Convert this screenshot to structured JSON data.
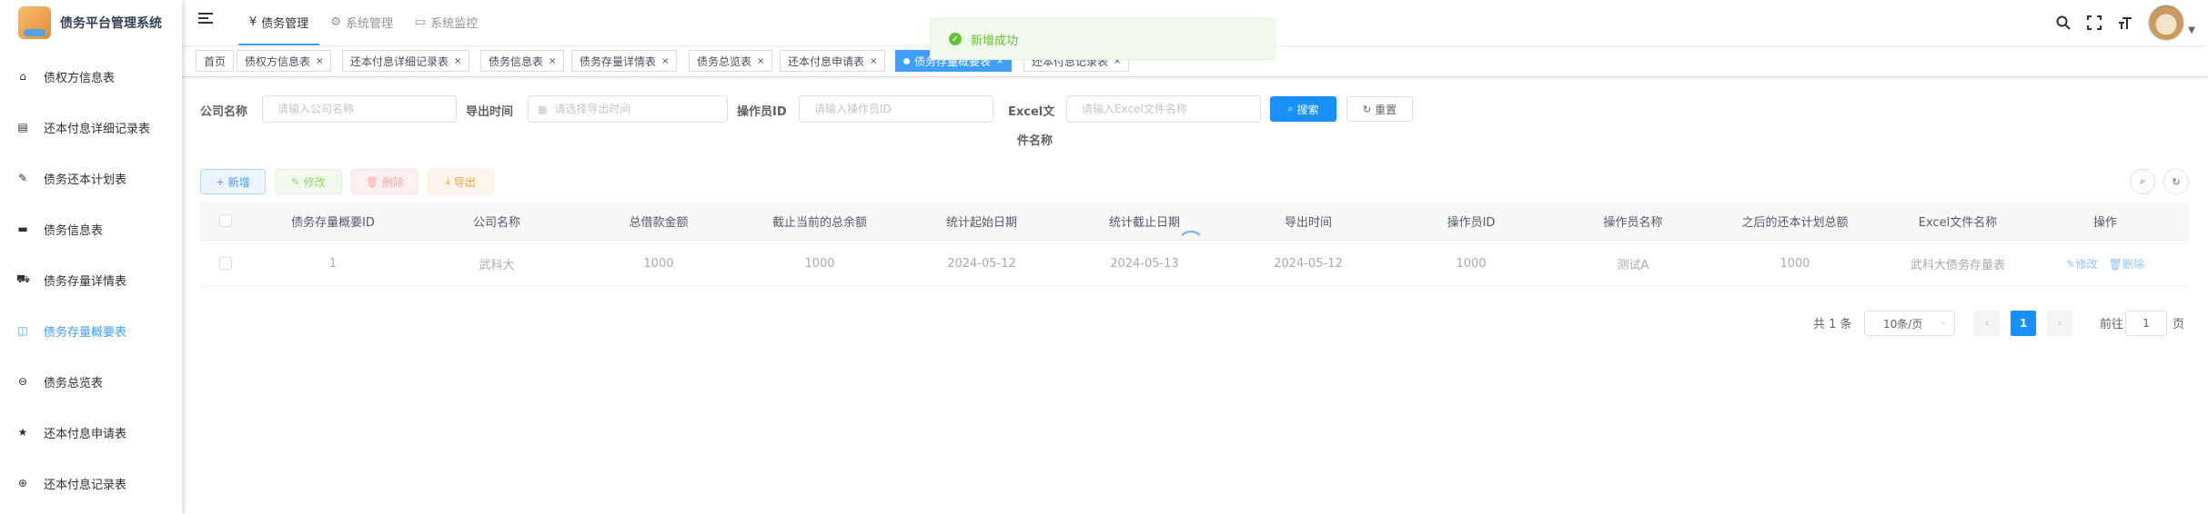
{
  "app": {
    "title": "债务平台管理系统"
  },
  "sidebar": {
    "items": [
      {
        "label": "债权方信息表",
        "icon": "tag-icon"
      },
      {
        "label": "还本付息详细记录表",
        "icon": "document-icon"
      },
      {
        "label": "债务还本计划表",
        "icon": "edit-icon"
      },
      {
        "label": "债务信息表",
        "icon": "message-icon"
      },
      {
        "label": "债务存量详情表",
        "icon": "cart-icon"
      },
      {
        "label": "债务存量概要表",
        "icon": "book-icon",
        "active": true
      },
      {
        "label": "债务总览表",
        "icon": "circle-minus-icon"
      },
      {
        "label": "还本付息申请表",
        "icon": "star-icon"
      },
      {
        "label": "还本付息记录表",
        "icon": "plus-circle-icon"
      }
    ]
  },
  "topnav": {
    "items": [
      {
        "label": "债务管理",
        "icon": "¥",
        "active": true
      },
      {
        "label": "系统管理",
        "icon": "⚙"
      },
      {
        "label": "系统监控",
        "icon": "▭"
      }
    ]
  },
  "tags": [
    {
      "label": "首页"
    },
    {
      "label": "债权方信息表"
    },
    {
      "label": "还本付息详细记录表"
    },
    {
      "label": "债务信息表"
    },
    {
      "label": "债务存量详情表"
    },
    {
      "label": "债务总览表"
    },
    {
      "label": "还本付息申请表"
    },
    {
      "label": "债务存量概要表",
      "active": true
    },
    {
      "label": "还本付息记录表"
    }
  ],
  "toast": {
    "message": "新增成功"
  },
  "search": {
    "company_label": "公司名称",
    "company_placeholder": "请输入公司名称",
    "export_time_label": "导出时间",
    "export_time_placeholder": "请选择导出时间",
    "operator_id_label": "操作员ID",
    "operator_id_placeholder": "请输入操作员ID",
    "excel_label_line1": "Excel文",
    "excel_label_line2": "件名称",
    "excel_placeholder": "请输入Excel文件名称",
    "search_button": "搜索",
    "reset_button": "重置"
  },
  "toolbar": {
    "add": "新增",
    "edit": "修改",
    "delete": "删除",
    "export": "导出"
  },
  "table": {
    "columns": [
      "债务存量概要ID",
      "公司名称",
      "总借款金额",
      "截止当前的总余额",
      "统计起始日期",
      "统计截止日期",
      "导出时间",
      "操作员ID",
      "操作员名称",
      "之后的还本计划总额",
      "Excel文件名称",
      "操作"
    ],
    "rows": [
      {
        "cells": [
          "1",
          "武科大",
          "1000",
          "1000",
          "2024-05-12",
          "2024-05-13",
          "2024-05-12",
          "1000",
          "测试A",
          "1000",
          "武科大债务存量表"
        ],
        "edit": "修改",
        "delete": "删除"
      }
    ]
  },
  "pagination": {
    "total": "共 1 条",
    "page_size": "10条/页",
    "current_page": "1",
    "prev": "‹",
    "next": "›",
    "goto_label": "前往",
    "goto_value": "1",
    "page_suffix": "页"
  },
  "colors": {
    "accent": "#409eff",
    "primary_button": "#1890ff",
    "success": "#67c23a"
  }
}
